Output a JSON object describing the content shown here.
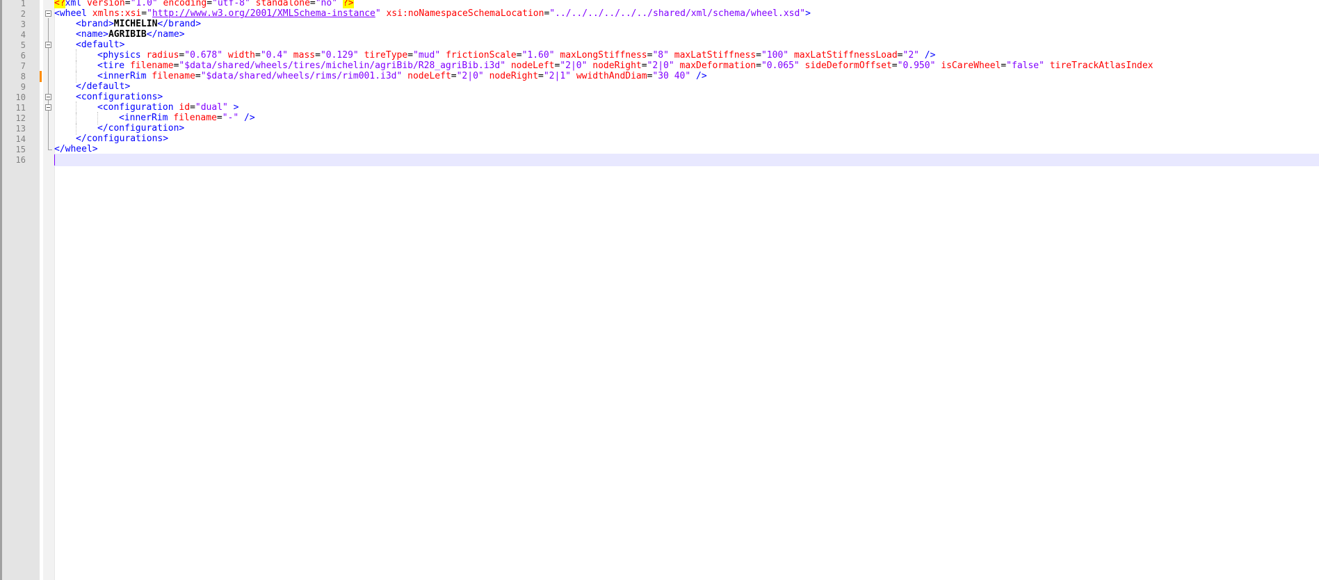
{
  "editor": {
    "language": "XML",
    "current_line": 16,
    "lines": [
      {
        "n": "1"
      },
      {
        "n": "2"
      },
      {
        "n": "3"
      },
      {
        "n": "4"
      },
      {
        "n": "5"
      },
      {
        "n": "6"
      },
      {
        "n": "7"
      },
      {
        "n": "8"
      },
      {
        "n": "9"
      },
      {
        "n": "10"
      },
      {
        "n": "11"
      },
      {
        "n": "12"
      },
      {
        "n": "13"
      },
      {
        "n": "14"
      },
      {
        "n": "15"
      },
      {
        "n": "16"
      }
    ],
    "code": {
      "l1": {
        "pi_open": "<?",
        "name": "xml",
        "a1": " version",
        "eq": "=",
        "v1": "\"1.0\"",
        "a2": " encoding",
        "v2": "\"utf-8\"",
        "a3": " standalone",
        "v3": "\"no\"",
        "pi_close": "?>"
      },
      "l2": {
        "open": "<wheel",
        "a1": " xmlns:xsi",
        "eq": "=",
        "q": "\"",
        "url": "http://www.w3.org/2001/XMLSchema-instance",
        "a2": " xsi:noNamespaceSchemaLocation",
        "v2": "\"../../../../../../shared/xml/schema/wheel.xsd\"",
        "close": ">"
      },
      "l3": {
        "open": "<brand>",
        "text": "MICHELIN",
        "close": "</brand>"
      },
      "l4": {
        "open": "<name>",
        "text": "AGRIBIB",
        "close": "</name>"
      },
      "l5": {
        "open": "<default>"
      },
      "l6": {
        "open": "<physics",
        "a1": " radius",
        "v1": "\"0.678\"",
        "a2": " width",
        "v2": "\"0.4\"",
        "a3": " mass",
        "v3": "\"0.129\"",
        "a4": " tireType",
        "v4": "\"mud\"",
        "a5": " frictionScale",
        "v5": "\"1.60\"",
        "a6": " maxLongStiffness",
        "v6": "\"8\"",
        "a7": " maxLatStiffness",
        "v7": "\"100\"",
        "a8": " maxLatStiffnessLoad",
        "v8": "\"2\"",
        "close": " />"
      },
      "l7": {
        "open": "<tire",
        "a1": " filename",
        "v1": "\"$data/shared/wheels/tires/michelin/agriBib/R28_agriBib.i3d\"",
        "a2": " nodeLeft",
        "v2": "\"2|0\"",
        "a3": " nodeRight",
        "v3": "\"2|0\"",
        "a4": " maxDeformation",
        "v4": "\"0.065\"",
        "a5": " sideDeformOffset",
        "v5": "\"0.950\"",
        "a6": " isCareWheel",
        "v6": "\"false\"",
        "a7": " tireTrackAtlasIndex"
      },
      "l8": {
        "open": "<innerRim",
        "a1": " filename",
        "v1": "\"$data/shared/wheels/rims/rim001.i3d\"",
        "a2": " nodeLeft",
        "v2": "\"2|0\"",
        "a3": " nodeRight",
        "v3": "\"2|1\"",
        "a4": " wwidthAndDiam",
        "v4": "\"30 40\"",
        "close": " />"
      },
      "l9": {
        "close": "</default>"
      },
      "l10": {
        "open": "<configurations>"
      },
      "l11": {
        "open": "<configuration",
        "a1": " id",
        "v1": "\"dual\"",
        "close": " >"
      },
      "l12": {
        "open": "<innerRim",
        "a1": " filename",
        "v1": "\"-\"",
        "close": " />"
      },
      "l13": {
        "close": "</configuration>"
      },
      "l14": {
        "close": "</configurations>"
      },
      "l15": {
        "close": "</wheel>"
      }
    }
  },
  "colors": {
    "tag": "#0000ff",
    "attribute": "#ff0000",
    "value": "#8000ff",
    "text": "#000000",
    "gutter": "#e4e4e4",
    "current_line": "#e8e8ff",
    "pi_highlight": "#ffff00",
    "change_marker": "#ff8c00"
  },
  "icons": {
    "fold": "fold-minus-icon"
  }
}
